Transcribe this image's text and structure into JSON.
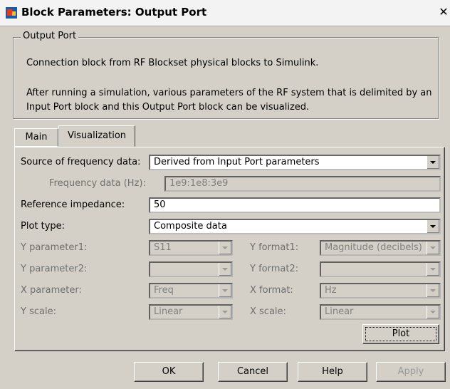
{
  "window": {
    "title": "Block Parameters: Output Port",
    "close_glyph": "✕"
  },
  "group": {
    "legend": "Output Port",
    "description_1": "Connection block from RF Blockset physical blocks to Simulink.",
    "description_2": "After running a simulation, various parameters of the RF system that is delimited by an Input Port block and this Output Port block can be visualized."
  },
  "tabs": [
    {
      "label": "Main"
    },
    {
      "label": "Visualization"
    }
  ],
  "form": {
    "source_label": "Source of frequency data:",
    "source_value": "Derived from Input Port parameters",
    "freq_label": "Frequency data (Hz):",
    "freq_value": "1e9:1e8:3e9",
    "impedance_label": "Reference impedance:",
    "impedance_value": "50",
    "plot_type_label": "Plot type:",
    "plot_type_value": "Composite data",
    "y_param1_label": "Y parameter1:",
    "y_param1_value": "S11",
    "y_format1_label": "Y format1:",
    "y_format1_value": "Magnitude (decibels)",
    "y_param2_label": "Y parameter2:",
    "y_param2_value": "",
    "y_format2_label": "Y format2:",
    "y_format2_value": "",
    "x_param_label": "X parameter:",
    "x_param_value": "Freq",
    "x_format_label": "X format:",
    "x_format_value": "Hz",
    "y_scale_label": "Y scale:",
    "y_scale_value": "Linear",
    "x_scale_label": "X scale:",
    "x_scale_value": "Linear",
    "plot_button": "Plot"
  },
  "buttons": {
    "ok": "OK",
    "cancel": "Cancel",
    "help": "Help",
    "apply": "Apply"
  }
}
